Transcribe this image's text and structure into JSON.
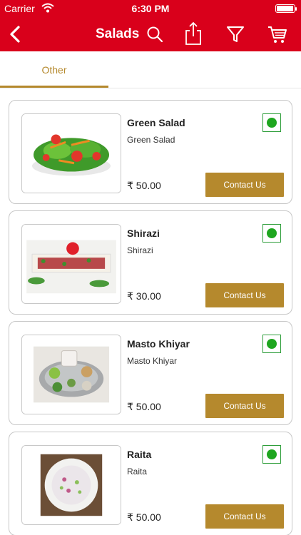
{
  "status_bar": {
    "carrier": "Carrier",
    "time": "6:30 PM"
  },
  "navbar": {
    "title": "Salads",
    "icons": [
      "back-chevron-icon",
      "search-icon",
      "share-icon",
      "filter-icon",
      "cart-icon"
    ]
  },
  "tabs": [
    {
      "label": "Other",
      "selected": true
    }
  ],
  "products": [
    {
      "name": "Green Salad",
      "description": "Green Salad",
      "price": "₹ 50.00",
      "veg": true,
      "button": "Contact Us"
    },
    {
      "name": "Shirazi",
      "description": "Shirazi",
      "price": "₹ 30.00",
      "veg": true,
      "button": "Contact Us"
    },
    {
      "name": "Masto Khiyar",
      "description": "Masto Khiyar",
      "price": "₹ 50.00",
      "veg": true,
      "button": "Contact Us"
    },
    {
      "name": "Raita",
      "description": "Raita",
      "price": "₹ 50.00",
      "veg": true,
      "button": "Contact Us"
    }
  ],
  "colors": {
    "header": "#d9001b",
    "accent": "#b5892d",
    "veg": "#1ea61f"
  }
}
